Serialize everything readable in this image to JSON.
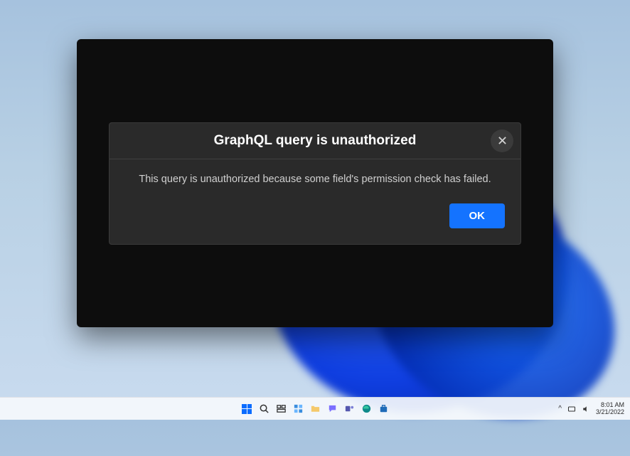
{
  "dialog": {
    "title": "GraphQL query is unauthorized",
    "message": "This query is unauthorized because some field's permission check has failed.",
    "ok_label": "OK"
  },
  "taskbar": {
    "icons": [
      "start",
      "search",
      "task-view",
      "widgets",
      "file-explorer",
      "chat",
      "teams",
      "edge",
      "store"
    ],
    "time": "8:01 AM",
    "date": "3/21/2022",
    "chevron": "^"
  }
}
